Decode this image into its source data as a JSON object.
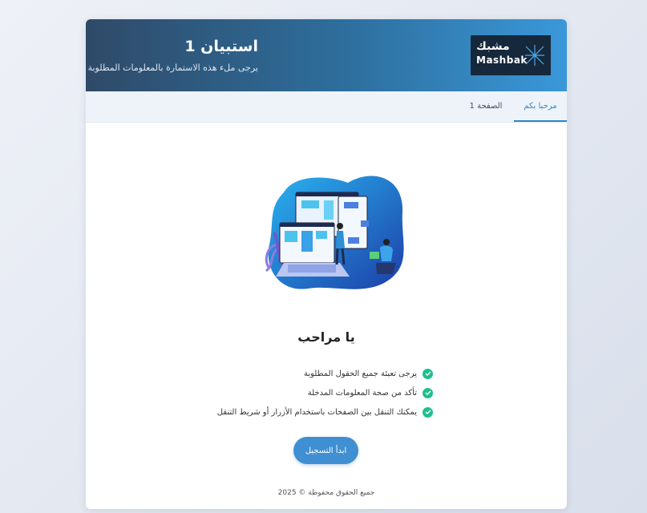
{
  "header": {
    "logo_ar": "مشبك",
    "logo_en": "Mashbak",
    "title": "استبيان 1",
    "subtitle": "يرجى ملء هذه الاستمارة بالمعلومات المطلوبة"
  },
  "tabs": [
    {
      "label": "مرحبا بكم",
      "active": true
    },
    {
      "label": "الصفحة 1",
      "active": false
    }
  ],
  "main": {
    "welcome": "يا مراحب",
    "items": [
      "يرجى تعبئة جميع الحقول المطلوبة",
      "تأكد من صحة المعلومات المدخلة",
      "يمكنك التنقل بين الصفحات باستخدام الأزرار أو شريط التنقل"
    ],
    "start_button": "ابدأ التسجيل"
  },
  "footer": "جميع الحقوق محفوظة © 2025",
  "colors": {
    "accent": "#2f86c9",
    "check": "#1fbf8f",
    "header_dark": "#2f4a68",
    "header_light": "#3a98d9"
  }
}
